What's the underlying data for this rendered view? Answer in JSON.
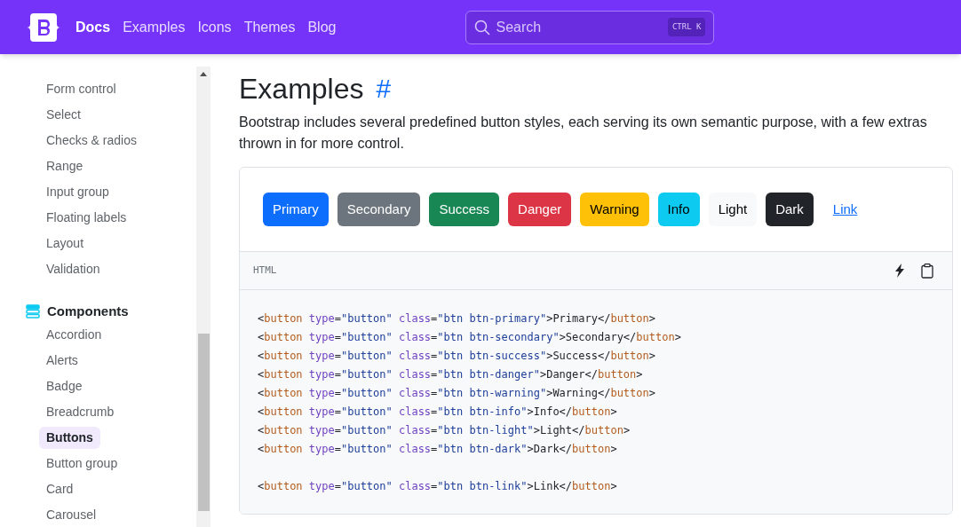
{
  "navbar": {
    "links": [
      {
        "label": "Docs",
        "selected": true
      },
      {
        "label": "Examples",
        "selected": false
      },
      {
        "label": "Icons",
        "selected": false
      },
      {
        "label": "Themes",
        "selected": false
      },
      {
        "label": "Blog",
        "selected": false
      }
    ],
    "search": {
      "placeholder": "Search",
      "shortcut": "CTRL K"
    }
  },
  "sidebar": {
    "items": [
      {
        "label": "Form control",
        "selected": false
      },
      {
        "label": "Select",
        "selected": false
      },
      {
        "label": "Checks & radios",
        "selected": false
      },
      {
        "label": "Range",
        "selected": false
      },
      {
        "label": "Input group",
        "selected": false
      },
      {
        "label": "Floating labels",
        "selected": false
      },
      {
        "label": "Layout",
        "selected": false
      },
      {
        "label": "Validation",
        "selected": false
      }
    ],
    "sections": [
      {
        "title": "Components",
        "items": [
          {
            "label": "Accordion",
            "selected": false
          },
          {
            "label": "Alerts",
            "selected": false
          },
          {
            "label": "Badge",
            "selected": false
          },
          {
            "label": "Breadcrumb",
            "selected": false
          },
          {
            "label": "Buttons",
            "selected": true
          },
          {
            "label": "Button group",
            "selected": false
          },
          {
            "label": "Card",
            "selected": false
          },
          {
            "label": "Carousel",
            "selected": false
          }
        ]
      }
    ]
  },
  "content": {
    "heading": "Examples",
    "anchor": "#",
    "intro": "Bootstrap includes several predefined button styles, each serving its own semantic purpose, with a few extras thrown in for more control.",
    "buttons": [
      {
        "label": "Primary",
        "kind": "primary"
      },
      {
        "label": "Secondary",
        "kind": "secondary"
      },
      {
        "label": "Success",
        "kind": "success"
      },
      {
        "label": "Danger",
        "kind": "danger"
      },
      {
        "label": "Warning",
        "kind": "warning"
      },
      {
        "label": "Info",
        "kind": "info"
      },
      {
        "label": "Light",
        "kind": "light"
      },
      {
        "label": "Dark",
        "kind": "dark"
      },
      {
        "label": "Link",
        "kind": "link"
      }
    ],
    "code": {
      "language": "HTML",
      "blocks": [
        [
          [
            {
              "kind": "punct",
              "text": "<"
            },
            {
              "kind": "tag",
              "text": "button"
            },
            {
              "kind": "attr",
              "text": " type"
            },
            {
              "kind": "punct",
              "text": "="
            },
            {
              "kind": "string",
              "text": "\"button\""
            },
            {
              "kind": "attr",
              "text": " class"
            },
            {
              "kind": "punct",
              "text": "="
            },
            {
              "kind": "string",
              "text": "\"btn btn-primary\""
            },
            {
              "kind": "punct",
              "text": ">Primary</"
            },
            {
              "kind": "tag",
              "text": "button"
            },
            {
              "kind": "punct",
              "text": ">"
            }
          ],
          [
            {
              "kind": "punct",
              "text": "<"
            },
            {
              "kind": "tag",
              "text": "button"
            },
            {
              "kind": "attr",
              "text": " type"
            },
            {
              "kind": "punct",
              "text": "="
            },
            {
              "kind": "string",
              "text": "\"button\""
            },
            {
              "kind": "attr",
              "text": " class"
            },
            {
              "kind": "punct",
              "text": "="
            },
            {
              "kind": "string",
              "text": "\"btn btn-secondary\""
            },
            {
              "kind": "punct",
              "text": ">Secondary</"
            },
            {
              "kind": "tag",
              "text": "button"
            },
            {
              "kind": "punct",
              "text": ">"
            }
          ],
          [
            {
              "kind": "punct",
              "text": "<"
            },
            {
              "kind": "tag",
              "text": "button"
            },
            {
              "kind": "attr",
              "text": " type"
            },
            {
              "kind": "punct",
              "text": "="
            },
            {
              "kind": "string",
              "text": "\"button\""
            },
            {
              "kind": "attr",
              "text": " class"
            },
            {
              "kind": "punct",
              "text": "="
            },
            {
              "kind": "string",
              "text": "\"btn btn-success\""
            },
            {
              "kind": "punct",
              "text": ">Success</"
            },
            {
              "kind": "tag",
              "text": "button"
            },
            {
              "kind": "punct",
              "text": ">"
            }
          ],
          [
            {
              "kind": "punct",
              "text": "<"
            },
            {
              "kind": "tag",
              "text": "button"
            },
            {
              "kind": "attr",
              "text": " type"
            },
            {
              "kind": "punct",
              "text": "="
            },
            {
              "kind": "string",
              "text": "\"button\""
            },
            {
              "kind": "attr",
              "text": " class"
            },
            {
              "kind": "punct",
              "text": "="
            },
            {
              "kind": "string",
              "text": "\"btn btn-danger\""
            },
            {
              "kind": "punct",
              "text": ">Danger</"
            },
            {
              "kind": "tag",
              "text": "button"
            },
            {
              "kind": "punct",
              "text": ">"
            }
          ],
          [
            {
              "kind": "punct",
              "text": "<"
            },
            {
              "kind": "tag",
              "text": "button"
            },
            {
              "kind": "attr",
              "text": " type"
            },
            {
              "kind": "punct",
              "text": "="
            },
            {
              "kind": "string",
              "text": "\"button\""
            },
            {
              "kind": "attr",
              "text": " class"
            },
            {
              "kind": "punct",
              "text": "="
            },
            {
              "kind": "string",
              "text": "\"btn btn-warning\""
            },
            {
              "kind": "punct",
              "text": ">Warning</"
            },
            {
              "kind": "tag",
              "text": "button"
            },
            {
              "kind": "punct",
              "text": ">"
            }
          ],
          [
            {
              "kind": "punct",
              "text": "<"
            },
            {
              "kind": "tag",
              "text": "button"
            },
            {
              "kind": "attr",
              "text": " type"
            },
            {
              "kind": "punct",
              "text": "="
            },
            {
              "kind": "string",
              "text": "\"button\""
            },
            {
              "kind": "attr",
              "text": " class"
            },
            {
              "kind": "punct",
              "text": "="
            },
            {
              "kind": "string",
              "text": "\"btn btn-info\""
            },
            {
              "kind": "punct",
              "text": ">Info</"
            },
            {
              "kind": "tag",
              "text": "button"
            },
            {
              "kind": "punct",
              "text": ">"
            }
          ],
          [
            {
              "kind": "punct",
              "text": "<"
            },
            {
              "kind": "tag",
              "text": "button"
            },
            {
              "kind": "attr",
              "text": " type"
            },
            {
              "kind": "punct",
              "text": "="
            },
            {
              "kind": "string",
              "text": "\"button\""
            },
            {
              "kind": "attr",
              "text": " class"
            },
            {
              "kind": "punct",
              "text": "="
            },
            {
              "kind": "string",
              "text": "\"btn btn-light\""
            },
            {
              "kind": "punct",
              "text": ">Light</"
            },
            {
              "kind": "tag",
              "text": "button"
            },
            {
              "kind": "punct",
              "text": ">"
            }
          ],
          [
            {
              "kind": "punct",
              "text": "<"
            },
            {
              "kind": "tag",
              "text": "button"
            },
            {
              "kind": "attr",
              "text": " type"
            },
            {
              "kind": "punct",
              "text": "="
            },
            {
              "kind": "string",
              "text": "\"button\""
            },
            {
              "kind": "attr",
              "text": " class"
            },
            {
              "kind": "punct",
              "text": "="
            },
            {
              "kind": "string",
              "text": "\"btn btn-dark\""
            },
            {
              "kind": "punct",
              "text": ">Dark</"
            },
            {
              "kind": "tag",
              "text": "button"
            },
            {
              "kind": "punct",
              "text": ">"
            }
          ]
        ],
        [
          [
            {
              "kind": "punct",
              "text": "<"
            },
            {
              "kind": "tag",
              "text": "button"
            },
            {
              "kind": "attr",
              "text": " type"
            },
            {
              "kind": "punct",
              "text": "="
            },
            {
              "kind": "string",
              "text": "\"button\""
            },
            {
              "kind": "attr",
              "text": " class"
            },
            {
              "kind": "punct",
              "text": "="
            },
            {
              "kind": "string",
              "text": "\"btn btn-link\""
            },
            {
              "kind": "punct",
              "text": ">Link</"
            },
            {
              "kind": "tag",
              "text": "button"
            },
            {
              "kind": "punct",
              "text": ">"
            }
          ]
        ]
      ]
    }
  }
}
